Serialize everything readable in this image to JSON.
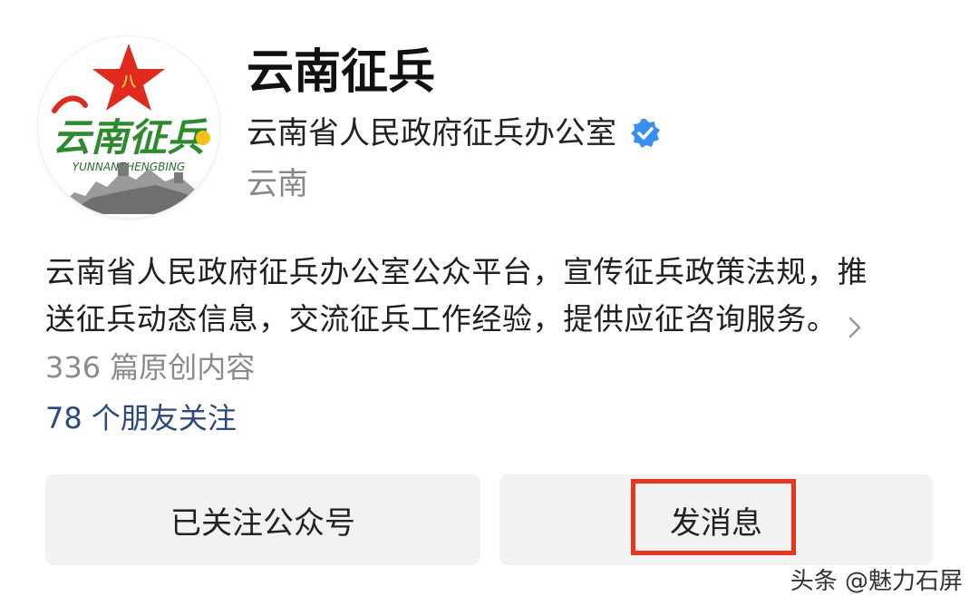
{
  "profile": {
    "account_name": "云南征兵",
    "org_name": "云南省人民政府征兵办公室",
    "location": "云南",
    "verified_icon": "verified-badge-icon",
    "avatar": {
      "logo_text": "云南征兵",
      "logo_subtext": "YUNNANZHENGBING",
      "star_color": "#e02a1e",
      "text_color": "#2e8a2e"
    }
  },
  "description": {
    "line1": "云南省人民政府征兵办公室公众平台，宣传征兵政策法规，推",
    "line2": "送征兵动态信息，交流征兵工作经验，提供应征咨询服务。"
  },
  "stats": {
    "article_count": "336 篇原创内容",
    "friends_following": "78 个朋友关注"
  },
  "actions": {
    "following_label": "已关注公众号",
    "message_label": "发消息"
  },
  "watermark": "头条 @魅力石屏",
  "colors": {
    "verified": "#3a8ef0",
    "friends_link": "#2a4a7f",
    "highlight": "#e8361e",
    "button_bg": "#f2f2f2"
  }
}
